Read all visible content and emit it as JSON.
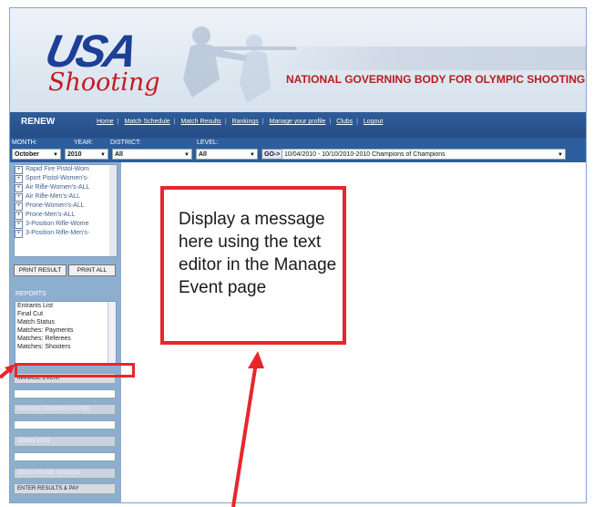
{
  "banner": {
    "logo_usa": "USA",
    "logo_shooting": "Shooting",
    "tagline": "NATIONAL GOVERNING BODY FOR OLYMPIC SHOOTING SPORTS"
  },
  "nav": {
    "renew": "RENEW",
    "links": [
      "Home",
      "Match Schedule",
      "Match Results",
      "Rankings",
      "Manage your profile",
      "Clubs",
      "Logout"
    ]
  },
  "filters": {
    "month_label": "MONTH:",
    "month_value": "October",
    "year_label": "YEAR:",
    "year_value": "2010",
    "district_label": "DISTRICT:",
    "district_value": "All",
    "level_label": "LEVEL:",
    "level_value": "All",
    "go_label": "GO->",
    "match_value": "10/04/2010 - 10/10/2010-2010 Champions of Champions"
  },
  "events": [
    "Rapid Fire Pistol-Wom",
    "Sport Pistol-Women's-",
    "Air Rifle-Women's-ALL",
    "Air Rifle-Men's-ALL",
    "Prone-Women's-ALL",
    "Prone-Men's-ALL",
    "3-Position Rifle-Wome",
    "3-Position Rifle-Men's-"
  ],
  "sidebar": {
    "print_result": "PRINT RESULT",
    "print_all": "PRINT ALL",
    "reports_label": "REPORTS",
    "reports": [
      "Entrants List",
      "Final Cut",
      "Match Status",
      "Matches: Payments",
      "Matches: Referees",
      "Matches: Shooters"
    ],
    "manage_event": "MANAGE EVENT",
    "manage_division_player": "MANAGE DIVISION PLAYER",
    "admin_view": "ADMIN VIEW",
    "open_iframe_window": "OPEN IFRAME WINDOW",
    "enter_results_pay": "ENTER RESULTS & PAY"
  },
  "annotation": {
    "message": "Display a message here using the text editor in the Manage Event page"
  },
  "colors": {
    "nav_blue": "#2d5d9c",
    "sidebar_blue": "#8eaed0",
    "annotation_red": "#e8262a",
    "tagline_red": "#b71c1c"
  }
}
